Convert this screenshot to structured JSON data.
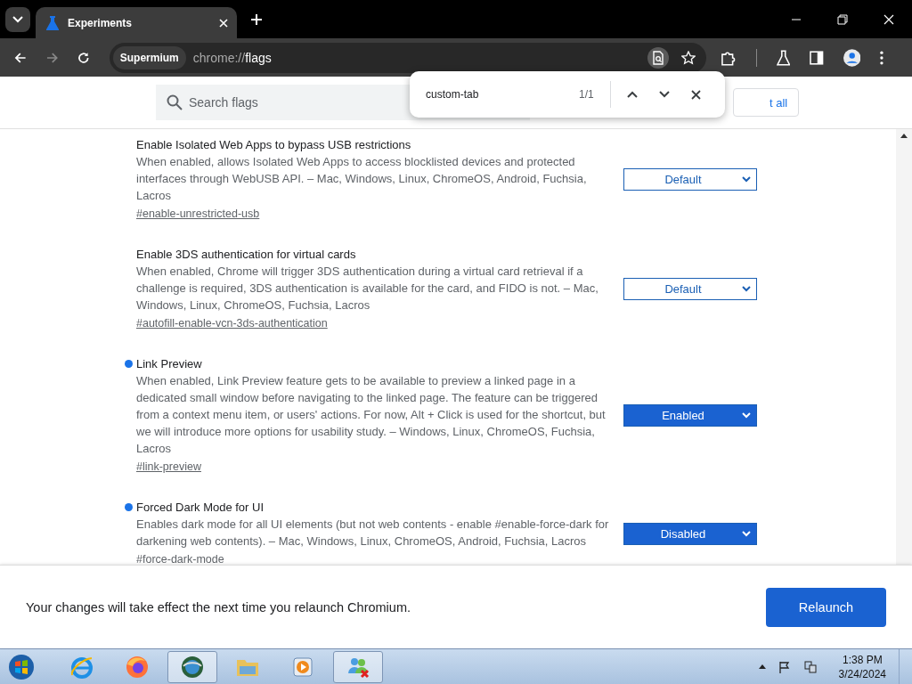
{
  "tab": {
    "title": "Experiments",
    "selected": true
  },
  "address": {
    "chip": "Supermium",
    "prefix": "chrome://",
    "path": "flags"
  },
  "search": {
    "placeholder": "Search flags"
  },
  "reset_button": {
    "label": "t all"
  },
  "find_bar": {
    "query": "custom-tab",
    "count": "1/1"
  },
  "flags": [
    {
      "title": "Enable Isolated Web Apps to bypass USB restrictions",
      "description": "When enabled, allows Isolated Web Apps to access blocklisted devices and protected interfaces through WebUSB API. – Mac, Windows, Linux, ChromeOS, Android, Fuchsia, Lacros",
      "link": "#enable-unrestricted-usb",
      "value": "Default",
      "modified": false
    },
    {
      "title": "Enable 3DS authentication for virtual cards",
      "description": "When enabled, Chrome will trigger 3DS authentication during a virtual card retrieval if a challenge is required, 3DS authentication is available for the card, and FIDO is not. – Mac, Windows, Linux, ChromeOS, Fuchsia, Lacros",
      "link": "#autofill-enable-vcn-3ds-authentication",
      "value": "Default",
      "modified": false
    },
    {
      "title": "Link Preview",
      "description": "When enabled, Link Preview feature gets to be available to preview a linked page in a dedicated small window before navigating to the linked page. The feature can be triggered from a context menu item, or users' actions. For now, Alt + Click is used for the shortcut, but we will introduce more options for usability study. – Windows, Linux, ChromeOS, Fuchsia, Lacros",
      "link": "#link-preview",
      "value": "Enabled",
      "modified": true
    },
    {
      "title": "Forced Dark Mode for UI",
      "description": "Enables dark mode for all UI elements (but not web contents - enable #enable-force-dark for darkening web contents). – Mac, Windows, Linux, ChromeOS, Android, Fuchsia, Lacros",
      "link": "#force-dark-mode",
      "value": "Disabled",
      "modified": true
    }
  ],
  "relaunch_bar": {
    "message": "Your changes will take effect the next time you relaunch Chromium.",
    "button": "Relaunch"
  },
  "taskbar": {
    "items": [
      {
        "kind": "ie",
        "selected": false
      },
      {
        "kind": "firefox",
        "selected": false
      },
      {
        "kind": "globe",
        "selected": true
      },
      {
        "kind": "folder",
        "selected": false
      },
      {
        "kind": "media",
        "selected": false
      },
      {
        "kind": "people",
        "selected": true
      }
    ],
    "time": "1:38 PM",
    "date": "3/24/2024"
  }
}
